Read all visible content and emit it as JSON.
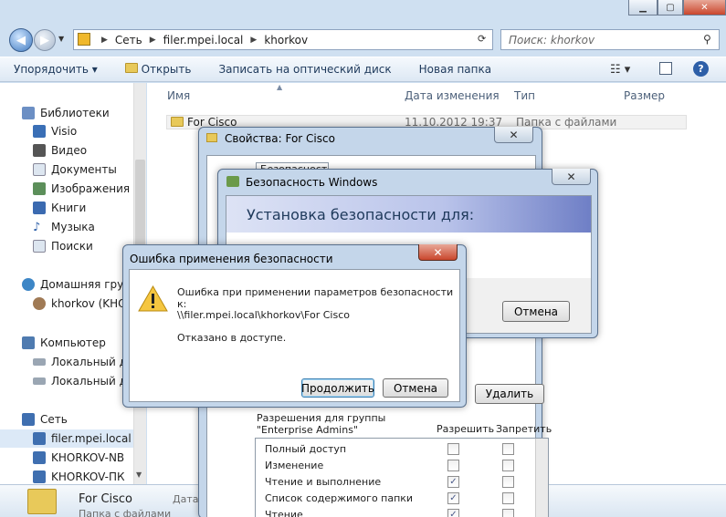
{
  "explorer": {
    "address_crumbs": [
      "Сеть",
      "filer.mpei.local",
      "khorkov"
    ],
    "search_placeholder": "Поиск: khorkov",
    "toolbar": {
      "organize": "Упорядочить",
      "open": "Открыть",
      "burn": "Записать на оптический диск",
      "new_folder": "Новая папка"
    },
    "nav": {
      "libraries": "Библиотеки",
      "lib_items": [
        "Visio",
        "Видео",
        "Документы",
        "Изображения",
        "Книги",
        "Музыка",
        "Поиски"
      ],
      "homegroup": "Домашняя групп",
      "homegroup_user": "khorkov (KHOR",
      "computer": "Компьютер",
      "computer_items": [
        "Локальный ди",
        "Локальный ди"
      ],
      "network": "Сеть",
      "network_items": [
        "filer.mpei.local",
        "KHORKOV-NB",
        "KHORKOV-ПК"
      ]
    },
    "columns": {
      "name": "Имя",
      "date": "Дата изменения",
      "type": "Тип",
      "size": "Размер"
    },
    "row": {
      "name": "For Cisco",
      "date": "11.10.2012 19:37",
      "type": "Папка с файлами"
    },
    "details": {
      "name": "For Cisco",
      "type": "Папка с файлами",
      "date_label": "Дата"
    }
  },
  "properties_dialog": {
    "title": "Свойства: For Cisco",
    "tab_security": "Безопасность",
    "remove_button": "Удалить",
    "perm_header": "Разрешения для группы \"Enterprise Admins\"",
    "allow": "Разрешить",
    "deny": "Запретить",
    "permissions": [
      {
        "name": "Полный доступ",
        "allow": "",
        "deny": ""
      },
      {
        "name": "Изменение",
        "allow": "",
        "deny": ""
      },
      {
        "name": "Чтение и выполнение",
        "allow": "✓",
        "deny": ""
      },
      {
        "name": "Список содержимого папки",
        "allow": "✓",
        "deny": ""
      },
      {
        "name": "Чтение",
        "allow": "✓",
        "deny": ""
      }
    ]
  },
  "security_dialog": {
    "title": "Безопасность Windows",
    "heading": "Установка безопасности для:",
    "cancel": "Отмена"
  },
  "error_dialog": {
    "title": "Ошибка применения безопасности",
    "message": "Ошибка при применении параметров безопасности к:",
    "path": "\\\\filer.mpei.local\\khorkov\\For Cisco",
    "detail": "Отказано в доступе.",
    "continue": "Продолжить",
    "cancel": "Отмена"
  },
  "colors": {
    "close": "#c9462c",
    "banner": "#6f7fc6",
    "accent": "#1e395b"
  }
}
